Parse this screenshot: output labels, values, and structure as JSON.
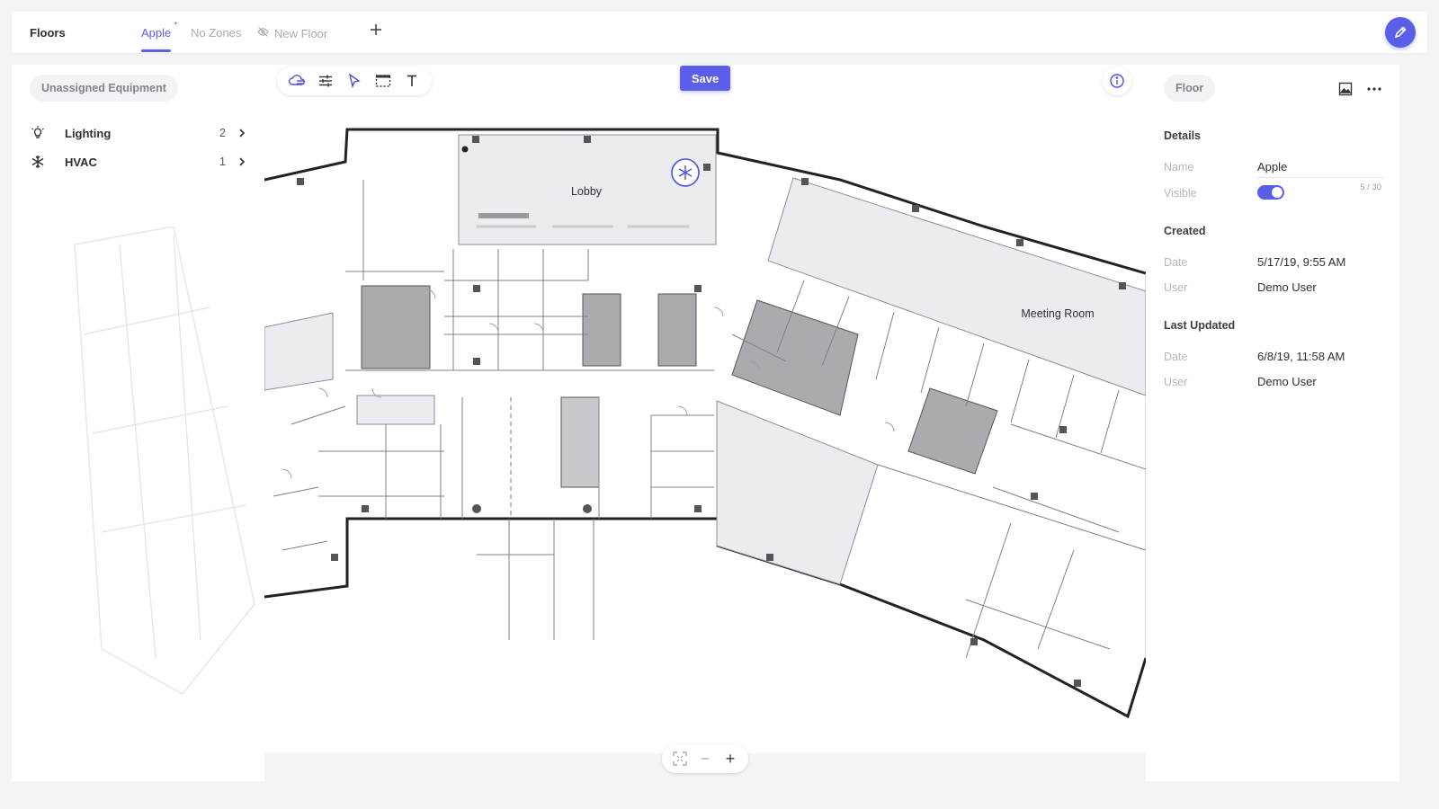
{
  "topbar": {
    "title": "Floors",
    "tabs": [
      {
        "label": "Apple",
        "active": true,
        "unsaved_marker": "*"
      },
      {
        "label": "No Zones"
      },
      {
        "label": "New Floor",
        "hidden_icon": "eye-off-icon"
      }
    ],
    "add_tab_icon": "plus-icon",
    "edit_icon": "pencil-icon"
  },
  "equipment_panel": {
    "chip": "Unassigned Equipment",
    "items": [
      {
        "label": "Lighting",
        "count": "2",
        "icon": "lightbulb-icon"
      },
      {
        "label": "HVAC",
        "count": "1",
        "icon": "snowflake-icon"
      }
    ]
  },
  "toolbar": {
    "tools": [
      "cloud-layers-icon",
      "sliders-icon",
      "pointer-icon",
      "select-area-icon",
      "text-icon"
    ]
  },
  "save_label": "Save",
  "floorplan": {
    "rooms": {
      "lobby": "Lobby",
      "meeting_room": "Meeting Room"
    }
  },
  "zoom": {
    "fit_icon": "fit-screen-icon",
    "minus": "−",
    "plus": "+"
  },
  "details_panel": {
    "chip": "Floor",
    "details_title": "Details",
    "name_label": "Name",
    "name_value": "Apple",
    "name_counter": "5 / 30",
    "visible_label": "Visible",
    "visible": true,
    "created_title": "Created",
    "created_date_label": "Date",
    "created_date": "5/17/19, 9:55 AM",
    "created_user_label": "User",
    "created_user": "Demo User",
    "updated_title": "Last Updated",
    "updated_date_label": "Date",
    "updated_date": "6/8/19, 11:58 AM",
    "updated_user_label": "User",
    "updated_user": "Demo User"
  },
  "colors": {
    "accent": "#5b5fe8",
    "unsaved": "#e0524d"
  }
}
